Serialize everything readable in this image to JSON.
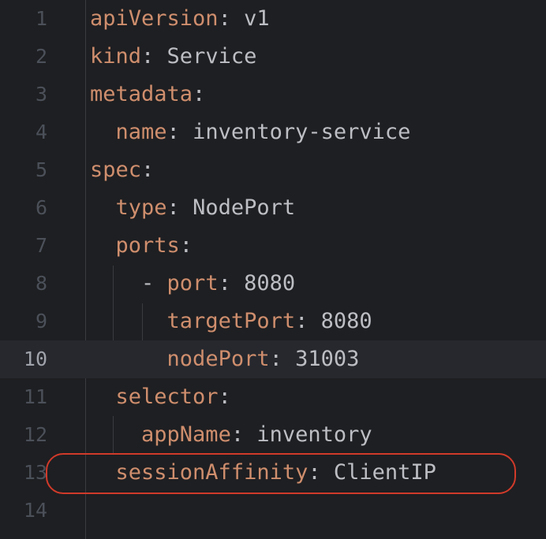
{
  "editor": {
    "lines": [
      {
        "number": "1",
        "indent": "",
        "prefix": "",
        "key": "apiVersion",
        "colon": ":",
        "value": " v1"
      },
      {
        "number": "2",
        "indent": "",
        "prefix": "",
        "key": "kind",
        "colon": ":",
        "value": " Service"
      },
      {
        "number": "3",
        "indent": "",
        "prefix": "",
        "key": "metadata",
        "colon": ":",
        "value": ""
      },
      {
        "number": "4",
        "indent": "  ",
        "prefix": "",
        "key": "name",
        "colon": ":",
        "value": " inventory-service"
      },
      {
        "number": "5",
        "indent": "",
        "prefix": "",
        "key": "spec",
        "colon": ":",
        "value": ""
      },
      {
        "number": "6",
        "indent": "  ",
        "prefix": "",
        "key": "type",
        "colon": ":",
        "value": " NodePort"
      },
      {
        "number": "7",
        "indent": "  ",
        "prefix": "",
        "key": "ports",
        "colon": ":",
        "value": ""
      },
      {
        "number": "8",
        "indent": "    ",
        "prefix": "- ",
        "key": "port",
        "colon": ":",
        "value": " 8080"
      },
      {
        "number": "9",
        "indent": "      ",
        "prefix": "",
        "key": "targetPort",
        "colon": ":",
        "value": " 8080"
      },
      {
        "number": "10",
        "indent": "      ",
        "prefix": "",
        "key": "nodePort",
        "colon": ":",
        "value": " 31003"
      },
      {
        "number": "11",
        "indent": "  ",
        "prefix": "",
        "key": "selector",
        "colon": ":",
        "value": ""
      },
      {
        "number": "12",
        "indent": "    ",
        "prefix": "",
        "key": "appName",
        "colon": ":",
        "value": " inventory"
      },
      {
        "number": "13",
        "indent": "  ",
        "prefix": "",
        "key": "sessionAffinity",
        "colon": ":",
        "value": " ClientIP"
      },
      {
        "number": "14",
        "indent": "",
        "prefix": "",
        "key": "",
        "colon": "",
        "value": ""
      }
    ],
    "current_line": 10,
    "highlighted_line": 13,
    "colors": {
      "background": "#1e1f22",
      "current_line_bg": "#26282e",
      "key": "#cf8e6d",
      "text": "#bcbec4",
      "line_number": "#4b5059",
      "line_number_current": "#a1a3ab",
      "annotation_ring": "#d13a2a"
    }
  }
}
